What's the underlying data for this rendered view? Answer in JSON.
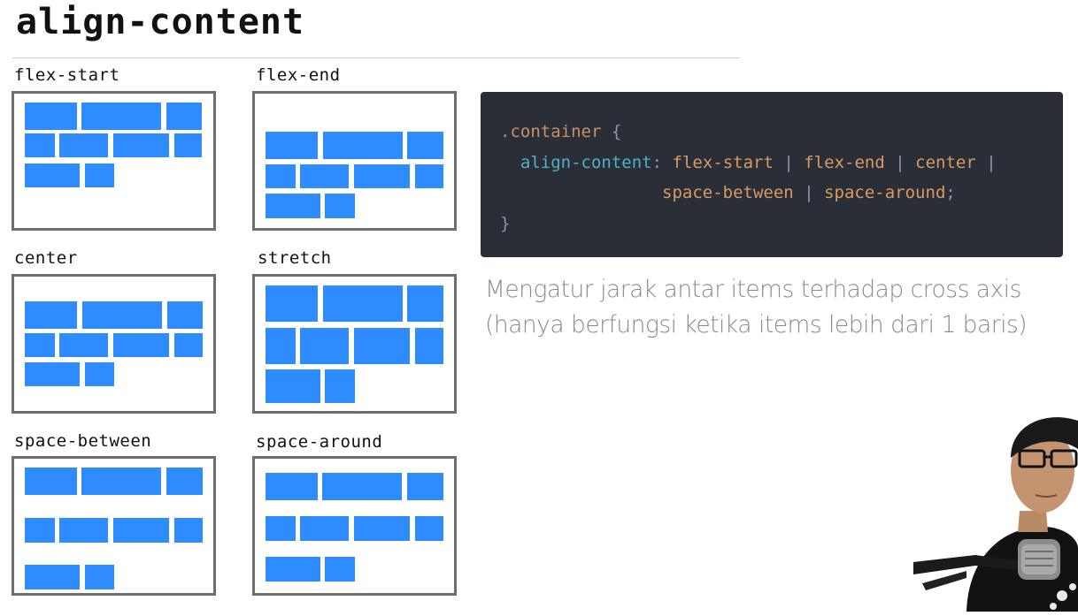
{
  "title": "align-content",
  "demos": [
    {
      "label": "flex-start"
    },
    {
      "label": "flex-end"
    },
    {
      "label": "center"
    },
    {
      "label": "stretch"
    },
    {
      "label": "space-between"
    },
    {
      "label": "space-around"
    }
  ],
  "code": {
    "selector": ".container",
    "open_brace": "{",
    "property": "align-content",
    "colon": ":",
    "values_line1": [
      "flex-start",
      "flex-end",
      "center"
    ],
    "values_line2": [
      "space-between",
      "space-around"
    ],
    "separator": "|",
    "terminator": ";",
    "close_brace": "}"
  },
  "description": {
    "line1": "Mengatur jarak antar items terhadap cross axis",
    "line2": "(hanya berfungsi ketika items lebih dari 1 baris)"
  },
  "colors": {
    "item": "#2f8cff",
    "box_border": "#6e6e6e",
    "code_bg": "#2a2e36"
  }
}
